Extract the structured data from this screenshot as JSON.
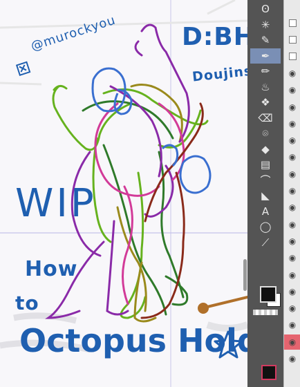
{
  "canvas": {
    "handle": "@murockyou",
    "title_line1": "D:BH",
    "title_line2": "Doujinshi",
    "wip": "WIP",
    "how": "How",
    "to": "to",
    "headline": "Octopus Hold",
    "headline_icon": "star-outline-icon",
    "handle_icon": "x-logo-icon",
    "accent_color": "#1f5fb0"
  },
  "toolbar": {
    "tools": [
      {
        "name": "lasso-icon",
        "glyph": "ʘ"
      },
      {
        "name": "magic-wand-icon",
        "glyph": "✳"
      },
      {
        "name": "eyedropper-icon",
        "glyph": "✎"
      },
      {
        "name": "pen-icon",
        "glyph": "✒",
        "active": true
      },
      {
        "name": "pencil-icon",
        "glyph": "✏"
      },
      {
        "name": "airbrush-icon",
        "glyph": "♨"
      },
      {
        "name": "decoration-icon",
        "glyph": "❖"
      },
      {
        "name": "eraser-icon",
        "glyph": "⌫"
      },
      {
        "name": "blend-icon",
        "glyph": "⌾"
      },
      {
        "name": "fill-icon",
        "glyph": "◆"
      },
      {
        "name": "gradient-icon",
        "glyph": "▤"
      },
      {
        "name": "figure-icon",
        "glyph": "⌒"
      },
      {
        "name": "ruler-icon",
        "glyph": "◣"
      },
      {
        "name": "text-icon",
        "glyph": "A"
      },
      {
        "name": "balloon-icon",
        "glyph": "◯"
      },
      {
        "name": "correct-line-icon",
        "glyph": "⟋"
      }
    ],
    "main_color": "#111111",
    "sub_color": "#ffffff"
  },
  "layers": {
    "rows": [
      {
        "icon": "checkbox-icon"
      },
      {
        "icon": "checkbox-icon"
      },
      {
        "icon": "checkbox-icon"
      },
      {
        "icon": "eye-icon"
      },
      {
        "icon": "eye-icon"
      },
      {
        "icon": "eye-icon"
      },
      {
        "icon": "eye-icon"
      },
      {
        "icon": "eye-icon"
      },
      {
        "icon": "eye-icon"
      },
      {
        "icon": "eye-icon"
      },
      {
        "icon": "eye-icon"
      },
      {
        "icon": "eye-icon"
      },
      {
        "icon": "eye-icon"
      },
      {
        "icon": "eye-icon"
      },
      {
        "icon": "eye-icon"
      },
      {
        "icon": "eye-icon"
      },
      {
        "icon": "eye-icon"
      },
      {
        "icon": "eye-icon"
      },
      {
        "icon": "eye-icon"
      },
      {
        "icon": "eye-icon",
        "selected": true
      },
      {
        "icon": "eye-icon"
      }
    ],
    "selected_color": "#e5646f"
  }
}
